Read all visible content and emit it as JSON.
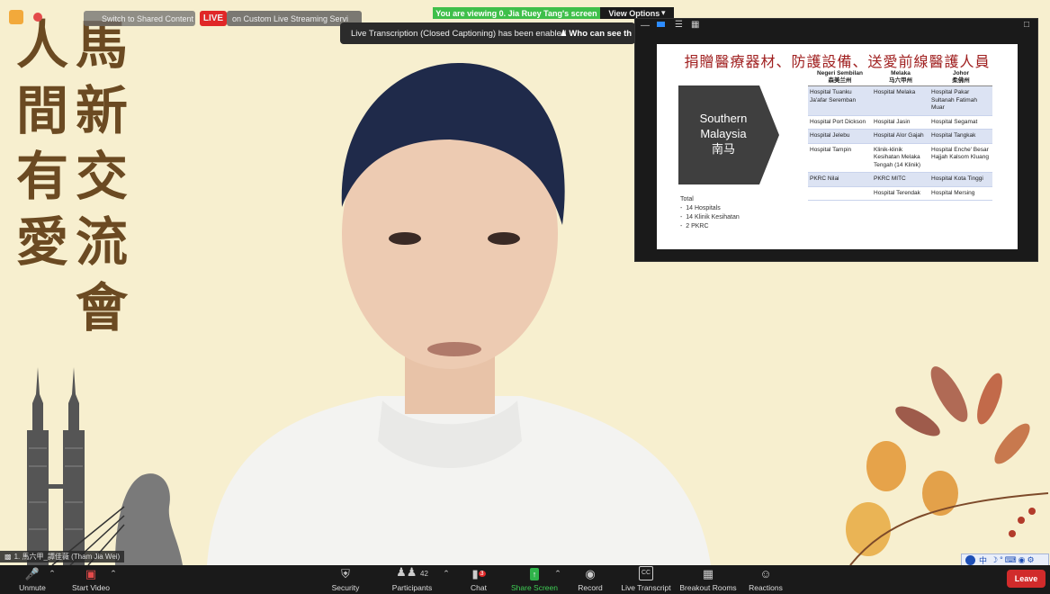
{
  "top_bar": {
    "switch_label": "Switch to Shared Content",
    "live_label": "LIVE",
    "live_text": "on Custom Live Streaming Servi",
    "viewing_text": "You are viewing 0. Jia Ruey Tang's screen",
    "view_options": "View Options"
  },
  "tooltip": {
    "text": "Live Transcription (Closed Captioning) has been enabled",
    "who_label": "Who can see th"
  },
  "background": {
    "calligraphy_left": [
      "人",
      "間",
      "有",
      "愛"
    ],
    "calligraphy_right": [
      "馬",
      "新",
      "交",
      "流",
      "會"
    ]
  },
  "slide": {
    "title": "捐贈醫療器材、防護設備、送愛前線醫護人員",
    "region": [
      "Southern",
      "Malaysia",
      "南马"
    ],
    "total_title": "Total",
    "total_items": [
      "14 Hospitals",
      "14 Klinik Kesihatan",
      "2 PKRC"
    ],
    "columns": [
      {
        "name": "Negeri Sembilan",
        "cn": "森美兰州"
      },
      {
        "name": "Melaka",
        "cn": "马六甲州"
      },
      {
        "name": "Johor",
        "cn": "柔佛州"
      }
    ],
    "rows": [
      [
        "Hospital Tuanku Ja'afar Seremban",
        "Hospital Melaka",
        "Hospital Pakar Sultanah Fatimah Muar"
      ],
      [
        "Hospital Port Dickson",
        "Hospital Jasin",
        "Hospital Segamat"
      ],
      [
        "Hospital Jelebu",
        "Hospital Alor Gajah",
        "Hospital Tangkak"
      ],
      [
        "Hospital Tampin",
        "Klinik-klinik Kesihatan Melaka Tengah (14 Klinik)",
        "Hospital Enche' Besar Hajjah Kalsom Kluang"
      ],
      [
        "PKRC Nilai",
        "PKRC MITC",
        "Hospital Kota Tinggi"
      ],
      [
        "",
        "Hospital Terendak",
        "Hospital Mersing"
      ]
    ]
  },
  "participant": {
    "name_tag": "1. 馬六甲_譚佳薇 (Tham Jia Wei)"
  },
  "toolbar": {
    "unmute": "Unmute",
    "start_video": "Start Video",
    "security": "Security",
    "participants": "Participants",
    "participant_count": "42",
    "chat": "Chat",
    "chat_badge": "3",
    "share_screen": "Share Screen",
    "record": "Record",
    "live_transcript": "Live Transcript",
    "breakout_rooms": "Breakout Rooms",
    "reactions": "Reactions",
    "leave": "Leave",
    "cc_icon_text": "CC"
  },
  "ime": {
    "text": "中"
  },
  "colors": {
    "background": "#f7efcf",
    "calligraphy": "#6b4a22",
    "viewing_bar": "#3fbf4a",
    "leave": "#d12b2b",
    "live": "#e02727",
    "slide_title": "#a02020"
  }
}
